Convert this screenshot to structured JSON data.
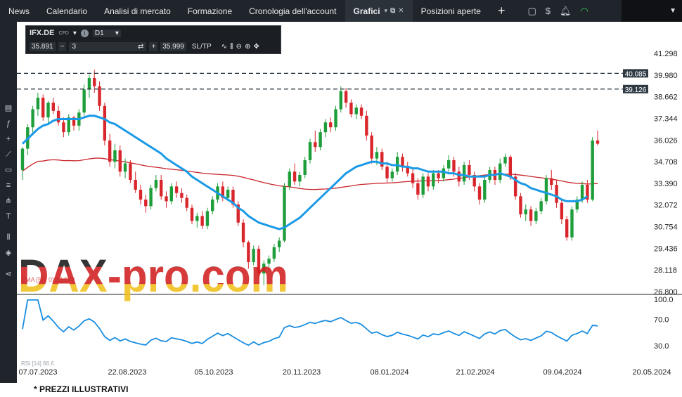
{
  "topbar": {
    "tabs": [
      {
        "label": "News"
      },
      {
        "label": "Calendario"
      },
      {
        "label": "Analisi di mercato"
      },
      {
        "label": "Formazione"
      },
      {
        "label": "Cronologia dell'account"
      },
      {
        "label": "Grafici"
      },
      {
        "label": "Posizioni aperte"
      }
    ],
    "plus": "+"
  },
  "toolbox": {
    "symbol": "IFX.DE",
    "instrument_type": "CFD",
    "timeframe": "D1",
    "bid": "35.891",
    "quantity": "3",
    "ask": "35.999",
    "sltp": "SL/TP"
  },
  "chart": {
    "price_axis": [
      "41.298",
      "39.980",
      "38.662",
      "37.344",
      "36.026",
      "34.708",
      "33.390",
      "32.072",
      "30.754",
      "29.436",
      "28.118",
      "26.800"
    ],
    "rsi_axis": [
      "100.0",
      "70.0",
      "30.0"
    ],
    "date_axis": [
      "07.07.2023",
      "22.08.2023",
      "05.10.2023",
      "20.11.2023",
      "08.01.2024",
      "21.02.2024",
      "09.04.2024",
      "20.05.2024"
    ],
    "levels": [
      "40.085",
      "39.126"
    ],
    "ema_label": "EMA [50, 0] 32.578",
    "rsi_label": "RSI [14] 66.6",
    "watermark": "DAX-pro.com"
  },
  "footer_note": "* PREZZI ILLUSTRATIVI",
  "chart_data": {
    "type": "candlestick",
    "ohlc": [
      [
        34.2,
        35.6,
        33.6,
        35.5
      ],
      [
        35.5,
        37.0,
        35.1,
        36.8
      ],
      [
        36.8,
        38.1,
        36.4,
        37.9
      ],
      [
        37.9,
        38.9,
        37.5,
        38.6
      ],
      [
        38.6,
        38.8,
        37.2,
        37.4
      ],
      [
        37.4,
        38.4,
        37.0,
        38.3
      ],
      [
        38.3,
        38.6,
        37.6,
        37.8
      ],
      [
        37.8,
        38.1,
        36.9,
        37.1
      ],
      [
        37.1,
        37.4,
        36.2,
        36.5
      ],
      [
        36.5,
        37.6,
        36.3,
        37.4
      ],
      [
        37.4,
        37.5,
        36.6,
        36.9
      ],
      [
        36.9,
        37.9,
        36.6,
        37.7
      ],
      [
        37.7,
        39.4,
        37.5,
        39.1
      ],
      [
        39.1,
        40.0,
        38.6,
        39.8
      ],
      [
        39.8,
        40.3,
        38.9,
        39.3
      ],
      [
        39.3,
        39.6,
        37.8,
        38.1
      ],
      [
        38.1,
        38.3,
        35.7,
        36.0
      ],
      [
        36.0,
        36.4,
        34.4,
        34.7
      ],
      [
        34.7,
        35.8,
        34.3,
        35.4
      ],
      [
        35.4,
        35.7,
        33.8,
        34.1
      ],
      [
        34.1,
        34.9,
        33.7,
        34.6
      ],
      [
        34.6,
        34.8,
        33.4,
        33.6
      ],
      [
        33.6,
        34.1,
        32.8,
        33.0
      ],
      [
        33.0,
        33.3,
        32.1,
        32.4
      ],
      [
        32.4,
        32.7,
        31.6,
        32.0
      ],
      [
        32.0,
        33.3,
        31.8,
        33.1
      ],
      [
        33.1,
        33.9,
        32.9,
        33.6
      ],
      [
        33.6,
        33.9,
        32.4,
        32.6
      ],
      [
        32.6,
        32.9,
        31.9,
        32.3
      ],
      [
        32.3,
        33.4,
        32.1,
        33.2
      ],
      [
        33.2,
        33.5,
        32.5,
        32.8
      ],
      [
        32.8,
        33.1,
        32.2,
        32.5
      ],
      [
        32.5,
        32.7,
        31.7,
        31.9
      ],
      [
        31.9,
        32.1,
        30.9,
        31.1
      ],
      [
        31.1,
        31.6,
        30.7,
        31.4
      ],
      [
        31.4,
        31.7,
        30.6,
        30.8
      ],
      [
        30.8,
        31.9,
        30.6,
        31.7
      ],
      [
        31.7,
        32.6,
        31.5,
        32.4
      ],
      [
        32.4,
        33.4,
        32.2,
        33.2
      ],
      [
        33.2,
        33.5,
        32.3,
        32.5
      ],
      [
        32.5,
        33.2,
        32.3,
        33.0
      ],
      [
        33.0,
        33.2,
        31.9,
        32.1
      ],
      [
        32.1,
        32.3,
        30.8,
        31.0
      ],
      [
        31.0,
        31.2,
        29.5,
        29.8
      ],
      [
        29.8,
        29.9,
        28.2,
        28.6
      ],
      [
        28.6,
        29.6,
        28.4,
        29.4
      ],
      [
        29.4,
        29.6,
        27.6,
        27.9
      ],
      [
        27.9,
        28.7,
        27.2,
        28.5
      ],
      [
        28.5,
        29.0,
        28.0,
        28.8
      ],
      [
        28.8,
        29.7,
        28.6,
        29.5
      ],
      [
        29.5,
        30.1,
        29.2,
        29.9
      ],
      [
        29.9,
        33.4,
        29.8,
        33.2
      ],
      [
        33.2,
        34.3,
        33.0,
        34.1
      ],
      [
        34.1,
        34.6,
        33.3,
        33.5
      ],
      [
        33.5,
        34.1,
        33.2,
        33.9
      ],
      [
        33.9,
        35.0,
        33.7,
        34.8
      ],
      [
        34.8,
        36.1,
        34.6,
        35.9
      ],
      [
        35.9,
        36.6,
        35.3,
        35.6
      ],
      [
        35.6,
        36.7,
        35.4,
        36.5
      ],
      [
        36.5,
        37.3,
        36.2,
        37.1
      ],
      [
        37.1,
        37.4,
        36.5,
        36.8
      ],
      [
        36.8,
        38.1,
        36.6,
        37.9
      ],
      [
        37.9,
        39.3,
        37.7,
        39.0
      ],
      [
        39.0,
        39.2,
        38.0,
        38.3
      ],
      [
        38.3,
        38.5,
        37.4,
        37.6
      ],
      [
        37.6,
        38.2,
        37.3,
        38.0
      ],
      [
        38.0,
        38.2,
        37.3,
        37.5
      ],
      [
        37.5,
        37.8,
        36.0,
        36.3
      ],
      [
        36.3,
        36.5,
        34.6,
        34.9
      ],
      [
        34.9,
        35.6,
        34.5,
        35.3
      ],
      [
        35.3,
        35.5,
        34.2,
        34.4
      ],
      [
        34.4,
        34.7,
        33.4,
        33.7
      ],
      [
        33.7,
        34.3,
        33.5,
        34.1
      ],
      [
        34.1,
        35.3,
        33.9,
        35.0
      ],
      [
        35.0,
        35.2,
        34.1,
        34.4
      ],
      [
        34.4,
        34.7,
        33.8,
        34.0
      ],
      [
        34.0,
        34.3,
        33.1,
        33.4
      ],
      [
        33.4,
        33.7,
        32.4,
        32.7
      ],
      [
        32.7,
        34.0,
        32.5,
        33.8
      ],
      [
        33.8,
        34.0,
        32.9,
        33.2
      ],
      [
        33.2,
        34.2,
        33.0,
        34.0
      ],
      [
        34.0,
        34.2,
        33.4,
        33.7
      ],
      [
        33.7,
        34.5,
        33.5,
        34.3
      ],
      [
        34.3,
        35.1,
        34.1,
        34.8
      ],
      [
        34.8,
        35.0,
        33.8,
        34.1
      ],
      [
        34.1,
        34.4,
        33.2,
        33.5
      ],
      [
        33.5,
        34.7,
        33.3,
        34.5
      ],
      [
        34.5,
        34.8,
        33.6,
        33.9
      ],
      [
        33.9,
        34.1,
        32.9,
        33.2
      ],
      [
        33.2,
        33.4,
        32.1,
        32.4
      ],
      [
        32.4,
        33.8,
        32.2,
        33.6
      ],
      [
        33.6,
        34.4,
        33.4,
        34.2
      ],
      [
        34.2,
        34.4,
        33.3,
        33.6
      ],
      [
        33.6,
        34.9,
        33.4,
        34.6
      ],
      [
        34.6,
        35.2,
        34.4,
        35.0
      ],
      [
        35.0,
        35.1,
        33.6,
        33.8
      ],
      [
        33.8,
        34.0,
        32.4,
        32.6
      ],
      [
        32.6,
        32.8,
        31.3,
        31.5
      ],
      [
        31.5,
        32.1,
        31.1,
        31.8
      ],
      [
        31.8,
        32.0,
        30.8,
        31.1
      ],
      [
        31.1,
        31.9,
        30.9,
        31.7
      ],
      [
        31.7,
        32.5,
        31.5,
        32.3
      ],
      [
        32.3,
        33.9,
        32.1,
        33.7
      ],
      [
        33.7,
        34.2,
        33.0,
        33.3
      ],
      [
        33.3,
        33.6,
        31.9,
        32.2
      ],
      [
        32.2,
        32.4,
        30.9,
        31.2
      ],
      [
        31.2,
        31.4,
        29.9,
        30.1
      ],
      [
        30.1,
        32.0,
        29.9,
        31.8
      ],
      [
        31.8,
        32.6,
        31.6,
        32.4
      ],
      [
        32.4,
        33.5,
        32.2,
        33.3
      ],
      [
        33.3,
        33.6,
        32.2,
        32.4
      ],
      [
        32.4,
        36.2,
        32.3,
        36.0
      ],
      [
        36.0,
        36.6,
        35.7,
        35.8
      ]
    ],
    "ema_blue": [
      35.8,
      36.1,
      36.4,
      36.7,
      36.9,
      37.0,
      37.2,
      37.3,
      37.3,
      37.3,
      37.3,
      37.3,
      37.4,
      37.5,
      37.5,
      37.4,
      37.3,
      37.1,
      37.0,
      36.8,
      36.6,
      36.4,
      36.2,
      36.0,
      35.8,
      35.6,
      35.4,
      35.2,
      34.9,
      34.7,
      34.5,
      34.3,
      34.1,
      33.8,
      33.6,
      33.4,
      33.2,
      33.0,
      32.8,
      32.6,
      32.4,
      32.2,
      31.9,
      31.7,
      31.4,
      31.2,
      31.0,
      30.9,
      30.8,
      30.7,
      30.6,
      30.7,
      30.9,
      31.1,
      31.3,
      31.6,
      31.9,
      32.2,
      32.5,
      32.8,
      33.1,
      33.4,
      33.7,
      34.0,
      34.2,
      34.4,
      34.5,
      34.6,
      34.7,
      34.7,
      34.6,
      34.6,
      34.5,
      34.5,
      34.4,
      34.4,
      34.3,
      34.3,
      34.2,
      34.1,
      34.1,
      34.1,
      34.1,
      34.0,
      34.0,
      33.9,
      33.9,
      33.8,
      33.8,
      33.8,
      33.8,
      33.9,
      33.9,
      34.0,
      33.9,
      33.8,
      33.6,
      33.4,
      33.3,
      33.1,
      33.0,
      32.9,
      32.8,
      32.7,
      32.6,
      32.4,
      32.3,
      32.3,
      32.3,
      32.4,
      32.6
    ]
  }
}
